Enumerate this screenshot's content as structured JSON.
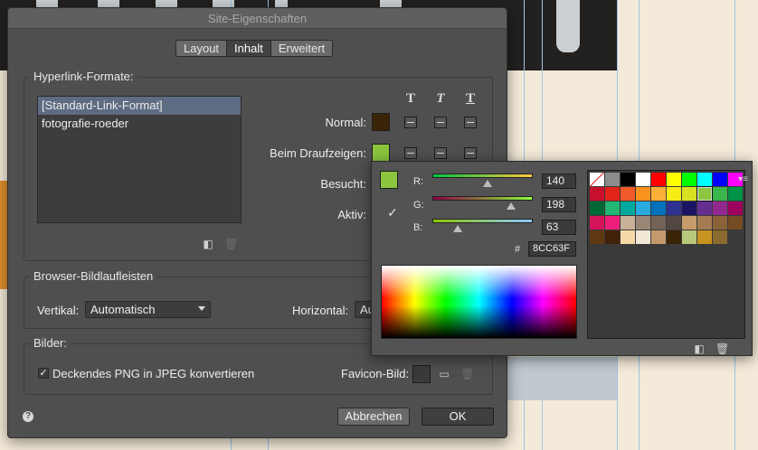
{
  "window": {
    "title": "Site-Eigenschaften"
  },
  "tabs": [
    {
      "label": "Layout",
      "active": false
    },
    {
      "label": "Inhalt",
      "active": true
    },
    {
      "label": "Erweitert",
      "active": false
    }
  ],
  "hyperlink": {
    "section_title": "Hyperlink-Formate:",
    "list": [
      "[Standard-Link-Format]",
      "fotografie-roeder"
    ],
    "selected_index": 0,
    "format_headers": [
      "T",
      "T",
      "T"
    ],
    "rows": [
      {
        "label": "Normal:",
        "color": "#3a2406"
      },
      {
        "label": "Beim Draufzeigen:",
        "color": "#8cc63f"
      },
      {
        "label": "Besucht:",
        "color": ""
      },
      {
        "label": "Aktiv:",
        "color": ""
      }
    ],
    "icons": {
      "new": "new-page-icon",
      "delete": "trash-icon"
    }
  },
  "scrollbars": {
    "section_title": "Browser-Bildlaufleisten",
    "vertical_label": "Vertikal:",
    "vertical_value": "Automatisch",
    "horizontal_label": "Horizontal:",
    "horizontal_value": "Au"
  },
  "images": {
    "section_title": "Bilder:",
    "checkbox_label": "Deckendes PNG in JPEG konvertieren",
    "checkbox_checked": true,
    "favicon_label": "Favicon-Bild:",
    "icons": {
      "folder": "folder-icon",
      "delete": "trash-icon"
    }
  },
  "footer": {
    "cancel": "Abbrechen",
    "ok": "OK",
    "help": "?"
  },
  "picker": {
    "current_color": "#8cc63f",
    "r_label": "R:",
    "g_label": "G:",
    "b_label": "B:",
    "r": "140",
    "g": "198",
    "b": "63",
    "r_level": 0.55,
    "g_level": 0.78,
    "b_level": 0.25,
    "hash": "#",
    "hex": "8CC63F",
    "palette": [
      [
        "none",
        "#8c8c8c",
        "#000000",
        "#ffffff",
        "#ff0000",
        "#ffff00",
        "#00ff00",
        "#00ffff",
        "#0000ff",
        "#ff00ff"
      ],
      [
        "#c8102e",
        "#e2231a",
        "#f05a28",
        "#f7931e",
        "#fbb03b",
        "#f7ec13",
        "#d9e021",
        "#8cc63f",
        "#39b54a",
        "#009245"
      ],
      [
        "#006837",
        "#22b573",
        "#00a99d",
        "#29abe2",
        "#0071bc",
        "#2e3192",
        "#1b1464",
        "#662d91",
        "#93278f",
        "#9e005d"
      ],
      [
        "#d4145a",
        "#ed1e79",
        "#c7b299",
        "#998675",
        "#736357",
        "#534741",
        "#c69c6d",
        "#a67c52",
        "#8c6239",
        "#754c24"
      ],
      [
        "#603813",
        "#42210b",
        "#f7d9a8",
        "#f2e8d5",
        "#c49a6c",
        "#3a2406",
        "#b7c87a",
        "#c7941f",
        "#8a6a2e",
        ""
      ]
    ],
    "selected_color": "#8cc63f"
  }
}
